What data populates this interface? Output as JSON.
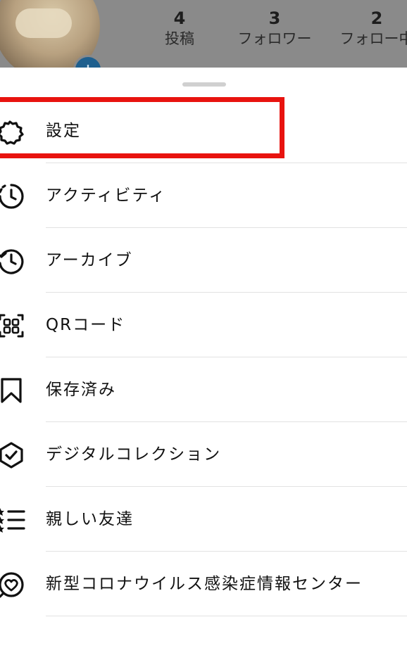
{
  "profile": {
    "stats": [
      {
        "count": "4",
        "label": "投稿"
      },
      {
        "count": "3",
        "label": "フォロワー"
      },
      {
        "count": "2",
        "label": "フォロー中"
      }
    ],
    "add_badge": "+"
  },
  "menu": {
    "items": [
      {
        "label": "設定",
        "icon": "gear-icon"
      },
      {
        "label": "アクティビティ",
        "icon": "activity-icon"
      },
      {
        "label": "アーカイブ",
        "icon": "archive-icon"
      },
      {
        "label": "QRコード",
        "icon": "qr-code-icon"
      },
      {
        "label": "保存済み",
        "icon": "bookmark-icon"
      },
      {
        "label": "デジタルコレクション",
        "icon": "verified-badge-icon"
      },
      {
        "label": "親しい友達",
        "icon": "close-friends-list-icon"
      },
      {
        "label": "新型コロナウイルス感染症情報センター",
        "icon": "covid-info-icon"
      }
    ]
  },
  "annotation": {
    "highlight_color": "#e8130f",
    "highlighted_item": "設定"
  }
}
